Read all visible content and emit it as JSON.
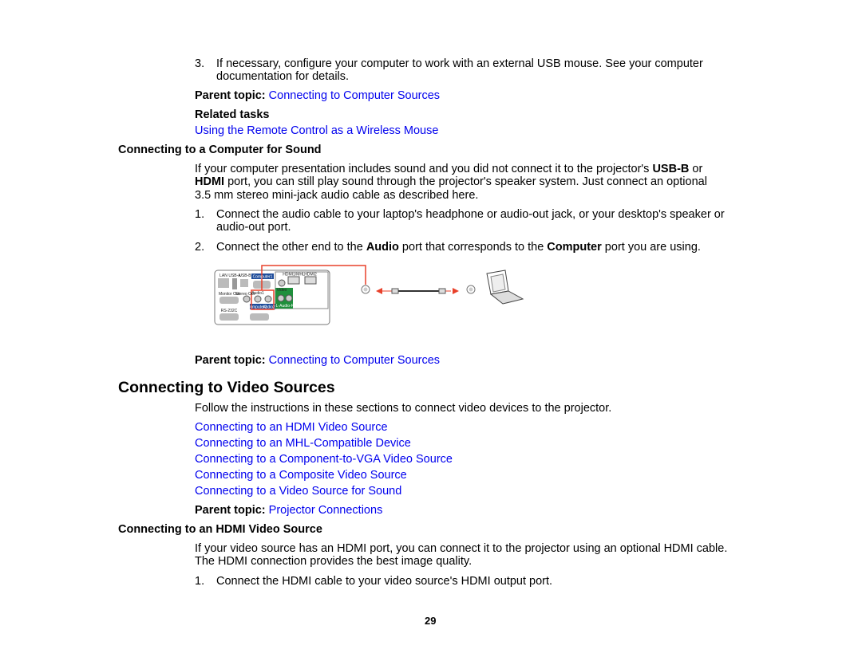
{
  "step3": {
    "num": "3.",
    "line1": "If necessary, configure your computer to work with an external USB mouse. See your computer",
    "line2": "documentation for details."
  },
  "parent1": {
    "label": "Parent topic:",
    "link": "Connecting to Computer Sources"
  },
  "related": {
    "label": "Related tasks",
    "link": "Using the Remote Control as a Wireless Mouse"
  },
  "sound": {
    "heading": "Connecting to a Computer for Sound",
    "p1a": "If your computer presentation includes sound and you did not connect it to the projector's ",
    "p1b": "USB-B",
    "p1c": " or",
    "p2a": "HDMI",
    "p2b": " port, you can still play sound through the projector's speaker system. Just connect an optional",
    "p3": "3.5 mm stereo mini-jack audio cable as described here.",
    "s1num": "1.",
    "s1a": "Connect the audio cable to your laptop's headphone or audio-out jack, or your desktop's speaker or",
    "s1b": "audio-out port.",
    "s2num": "2.",
    "s2a": "Connect the other end to the ",
    "s2b": "Audio",
    "s2c": " port that corresponds to the ",
    "s2d": "Computer",
    "s2e": " port you are using."
  },
  "illustration": {
    "labels": [
      "LAN",
      "USB-A",
      "USB-B",
      "Computer1",
      "HDMI1/MHL",
      "HDMI2",
      "Monitor Out",
      "Stereo Out",
      "Audio1",
      "Audio2",
      "Video",
      "L-Audio-R",
      "RS-232C",
      "Computer2"
    ]
  },
  "parent2": {
    "label": "Parent topic:",
    "link": "Connecting to Computer Sources"
  },
  "video": {
    "heading": "Connecting to Video Sources",
    "intro": "Follow the instructions in these sections to connect video devices to the projector.",
    "links": [
      "Connecting to an HDMI Video Source",
      "Connecting to an MHL-Compatible Device",
      "Connecting to a Component-to-VGA Video Source",
      "Connecting to a Composite Video Source",
      "Connecting to a Video Source for Sound"
    ],
    "parent_label": "Parent topic:",
    "parent_link": "Projector Connections"
  },
  "hdmi": {
    "heading": "Connecting to an HDMI Video Source",
    "p1": "If your video source has an HDMI port, you can connect it to the projector using an optional HDMI cable.",
    "p2": "The HDMI connection provides the best image quality.",
    "s1num": "1.",
    "s1": "Connect the HDMI cable to your video source's HDMI output port."
  },
  "page_number": "29",
  "colors": {
    "link": "#0000ee",
    "cable": "#e8402a"
  }
}
